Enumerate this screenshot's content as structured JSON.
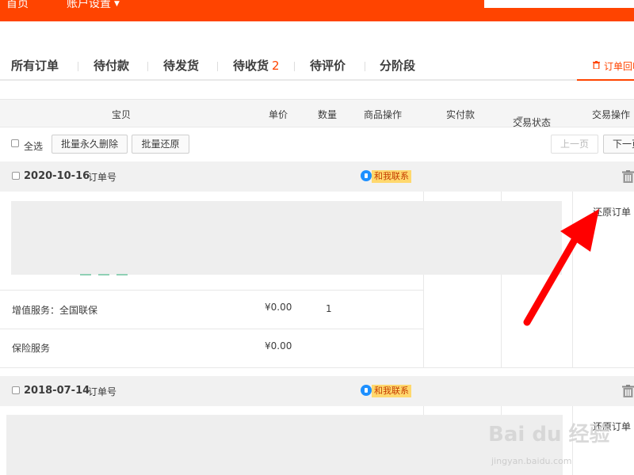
{
  "topbar": {
    "nav_home": "首页",
    "nav_account": "账户设置"
  },
  "tabs": [
    {
      "label": "所有订单"
    },
    {
      "label": "待付款"
    },
    {
      "label": "待发货"
    },
    {
      "label": "待收货",
      "count": "2"
    },
    {
      "label": "待评价"
    },
    {
      "label": "分阶段"
    }
  ],
  "recycle_label": "订单回收站",
  "columns": {
    "item": "宝贝",
    "unit_price": "单价",
    "quantity": "数量",
    "product_ops": "商品操作",
    "paid": "实付款",
    "status": "交易状态",
    "trade_ops": "交易操作"
  },
  "toolbar": {
    "select_all": "全选",
    "batch_delete": "批量永久删除",
    "batch_restore": "批量还原",
    "prev_page": "上一页",
    "next_page": "下一页"
  },
  "orders": [
    {
      "date": "2020-10-16",
      "order_no_label": "订单号",
      "chat_label": "和我联系",
      "restore_label": "还原订单",
      "services": [
        {
          "name": "增值服务：全国联保",
          "price": "¥0.00",
          "qty": "1"
        },
        {
          "name": "保险服务",
          "price": "¥0.00"
        }
      ]
    },
    {
      "date": "2018-07-14",
      "order_no_label": "订单号",
      "chat_label": "和我联系",
      "restore_label": "还原订单"
    }
  ],
  "watermark": {
    "logo": "Bai du 经验",
    "url": "jingyan.baidu.com"
  },
  "colors": {
    "brand": "#ff4400",
    "annotation_arrow": "#ff0000"
  }
}
